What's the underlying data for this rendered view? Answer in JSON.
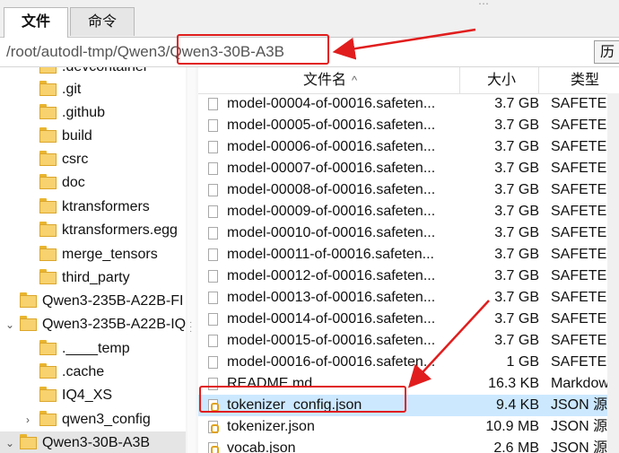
{
  "tabs": [
    {
      "label": "文件",
      "active": true
    },
    {
      "label": "命令",
      "active": false
    }
  ],
  "address": {
    "path_prefix": "/root/autodl-tmp/Qwen3",
    "path_last": "/Qwen3-30B-A3B",
    "history_label": "历"
  },
  "tree": {
    "items": [
      {
        "label": ".devcontainer"
      },
      {
        "label": ".git"
      },
      {
        "label": ".github"
      },
      {
        "label": "build"
      },
      {
        "label": "csrc"
      },
      {
        "label": "doc"
      },
      {
        "label": "ktransformers"
      },
      {
        "label": "ktransformers.egg"
      },
      {
        "label": "merge_tensors"
      },
      {
        "label": "third_party"
      },
      {
        "label": "Qwen3-235B-A22B-FI"
      },
      {
        "label": "Qwen3-235B-A22B-IQ"
      },
      {
        "label": ".____temp"
      },
      {
        "label": ".cache"
      },
      {
        "label": "IQ4_XS"
      },
      {
        "label": "qwen3_config"
      },
      {
        "label": "Qwen3-30B-A3B"
      }
    ]
  },
  "file_list": {
    "columns": {
      "name": "文件名",
      "size": "大小",
      "type": "类型"
    },
    "rows": [
      {
        "name": "model-00004-of-00016.safeten...",
        "size": "3.7 GB",
        "type": "SAFETEN..."
      },
      {
        "name": "model-00005-of-00016.safeten...",
        "size": "3.7 GB",
        "type": "SAFETEN..."
      },
      {
        "name": "model-00006-of-00016.safeten...",
        "size": "3.7 GB",
        "type": "SAFETEN..."
      },
      {
        "name": "model-00007-of-00016.safeten...",
        "size": "3.7 GB",
        "type": "SAFETEN..."
      },
      {
        "name": "model-00008-of-00016.safeten...",
        "size": "3.7 GB",
        "type": "SAFETEN..."
      },
      {
        "name": "model-00009-of-00016.safeten...",
        "size": "3.7 GB",
        "type": "SAFETEN..."
      },
      {
        "name": "model-00010-of-00016.safeten...",
        "size": "3.7 GB",
        "type": "SAFETEN..."
      },
      {
        "name": "model-00011-of-00016.safeten...",
        "size": "3.7 GB",
        "type": "SAFETEN..."
      },
      {
        "name": "model-00012-of-00016.safeten...",
        "size": "3.7 GB",
        "type": "SAFETEN..."
      },
      {
        "name": "model-00013-of-00016.safeten...",
        "size": "3.7 GB",
        "type": "SAFETEN..."
      },
      {
        "name": "model-00014-of-00016.safeten...",
        "size": "3.7 GB",
        "type": "SAFETEN..."
      },
      {
        "name": "model-00015-of-00016.safeten...",
        "size": "3.7 GB",
        "type": "SAFETEN..."
      },
      {
        "name": "model-00016-of-00016.safeten...",
        "size": "1 GB",
        "type": "SAFETEN..."
      },
      {
        "name": "README.md",
        "size": "16.3 KB",
        "type": "Markdow..."
      },
      {
        "name": "tokenizer_config.json",
        "size": "9.4 KB",
        "type": "JSON 源..."
      },
      {
        "name": "tokenizer.json",
        "size": "10.9 MB",
        "type": "JSON 源..."
      },
      {
        "name": "vocab.json",
        "size": "2.6 MB",
        "type": "JSON 源..."
      }
    ]
  },
  "annotation_color": "#e11d1d"
}
